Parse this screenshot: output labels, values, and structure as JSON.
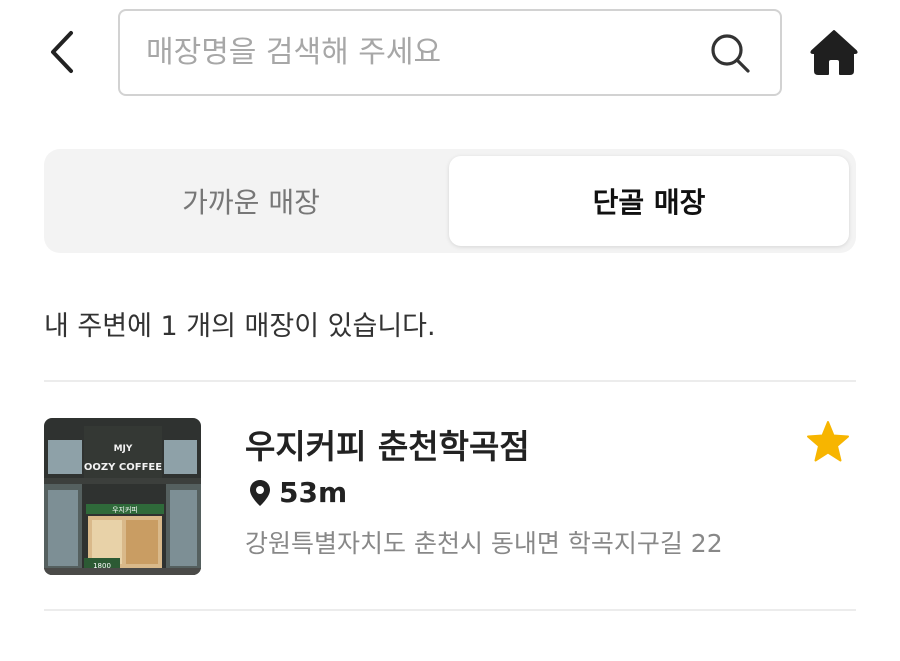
{
  "header": {
    "back_icon": "chevron-left-icon",
    "search_placeholder": "매장명을 검색해 주세요",
    "search_value": "",
    "search_icon": "search-icon",
    "home_icon": "home-icon"
  },
  "tabs": [
    {
      "label": "가까운 매장",
      "active": false
    },
    {
      "label": "단골 매장",
      "active": true
    }
  ],
  "summary": {
    "text": "내 주변에 1 개의 매장이 있습니다."
  },
  "stores": [
    {
      "name": "우지커피 춘천학곡점",
      "distance": "53m",
      "address": "강원특별자치도 춘천시 동내면 학곡지구길 22",
      "favorite": true,
      "thumbnail": {
        "sign_top": "MJY",
        "sign_main": "OOZY COFFEE",
        "banner": "우지커피",
        "price": "1800"
      }
    }
  ],
  "colors": {
    "star": "#F7B500",
    "text_primary": "#222222",
    "text_secondary": "#888888",
    "segment_bg": "#F3F3F3"
  }
}
